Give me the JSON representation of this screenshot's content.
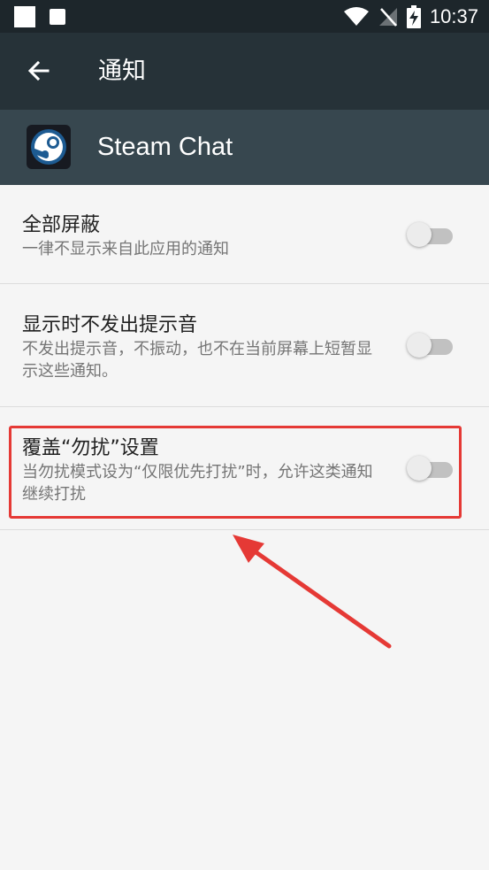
{
  "status_bar": {
    "time": "10:37",
    "icons": [
      "wifi-icon",
      "no-signal-icon",
      "battery-charging-icon"
    ]
  },
  "app_bar": {
    "title": "通知",
    "back_icon": "arrow-back-icon"
  },
  "app_header": {
    "name": "Steam Chat",
    "icon": "steam-logo-icon"
  },
  "settings": [
    {
      "title": "全部屏蔽",
      "description": "一律不显示来自此应用的通知",
      "enabled": false
    },
    {
      "title": "显示时不发出提示音",
      "description": "不发出提示音，不振动，也不在当前屏幕上短暂显示这些通知。",
      "enabled": false
    },
    {
      "title": "覆盖“勿扰”设置",
      "description": "当勿扰模式设为“仅限优先打扰”时，允许这类通知继续打扰",
      "enabled": false
    }
  ],
  "colors": {
    "status_bar": "#1d262b",
    "app_bar": "#263238",
    "app_header": "#37474f",
    "highlight": "#e53935"
  }
}
